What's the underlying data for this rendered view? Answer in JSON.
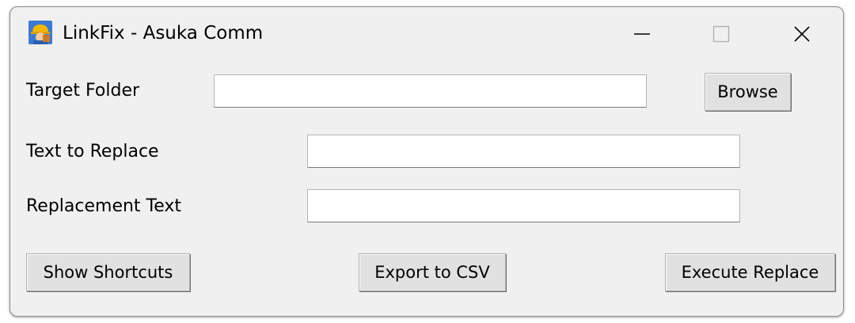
{
  "window": {
    "title": "LinkFix - Asuka Comm",
    "app_icon": "worker-helmet-icon",
    "controls": {
      "minimize": "minimize-icon",
      "maximize": "maximize-icon",
      "close": "close-icon"
    }
  },
  "form": {
    "target_folder": {
      "label": "Target Folder",
      "value": ""
    },
    "browse_label": "Browse",
    "text_to_replace": {
      "label": "Text to Replace",
      "value": ""
    },
    "replacement_text": {
      "label": "Replacement Text",
      "value": ""
    }
  },
  "actions": {
    "show_shortcuts_label": "Show Shortcuts",
    "export_csv_label": "Export to CSV",
    "execute_replace_label": "Execute Replace"
  },
  "colors": {
    "window_bg": "#f0f0f0",
    "button_bg": "#e1e1e1",
    "field_bg": "#ffffff"
  }
}
